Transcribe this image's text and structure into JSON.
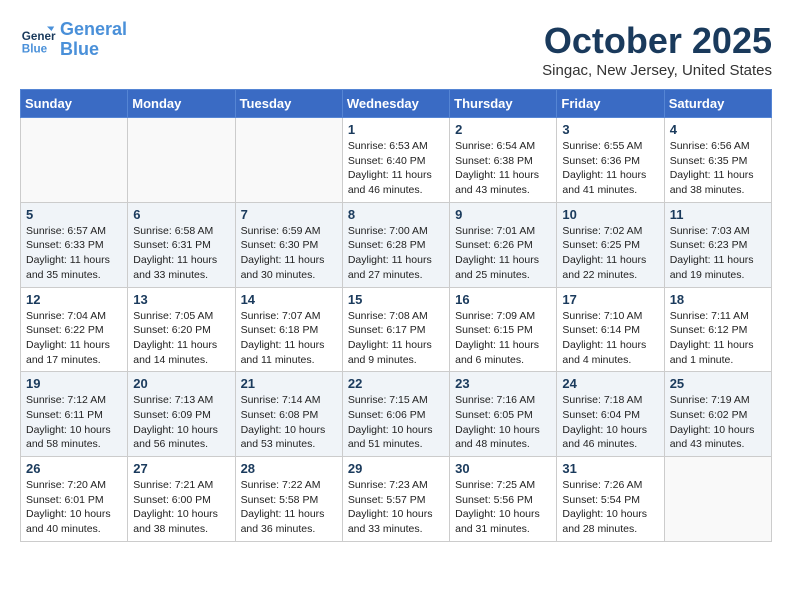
{
  "logo": {
    "line1": "General",
    "line2": "Blue"
  },
  "title": "October 2025",
  "location": "Singac, New Jersey, United States",
  "days_of_week": [
    "Sunday",
    "Monday",
    "Tuesday",
    "Wednesday",
    "Thursday",
    "Friday",
    "Saturday"
  ],
  "weeks": [
    [
      {
        "day": "",
        "info": ""
      },
      {
        "day": "",
        "info": ""
      },
      {
        "day": "",
        "info": ""
      },
      {
        "day": "1",
        "info": "Sunrise: 6:53 AM\nSunset: 6:40 PM\nDaylight: 11 hours and 46 minutes."
      },
      {
        "day": "2",
        "info": "Sunrise: 6:54 AM\nSunset: 6:38 PM\nDaylight: 11 hours and 43 minutes."
      },
      {
        "day": "3",
        "info": "Sunrise: 6:55 AM\nSunset: 6:36 PM\nDaylight: 11 hours and 41 minutes."
      },
      {
        "day": "4",
        "info": "Sunrise: 6:56 AM\nSunset: 6:35 PM\nDaylight: 11 hours and 38 minutes."
      }
    ],
    [
      {
        "day": "5",
        "info": "Sunrise: 6:57 AM\nSunset: 6:33 PM\nDaylight: 11 hours and 35 minutes."
      },
      {
        "day": "6",
        "info": "Sunrise: 6:58 AM\nSunset: 6:31 PM\nDaylight: 11 hours and 33 minutes."
      },
      {
        "day": "7",
        "info": "Sunrise: 6:59 AM\nSunset: 6:30 PM\nDaylight: 11 hours and 30 minutes."
      },
      {
        "day": "8",
        "info": "Sunrise: 7:00 AM\nSunset: 6:28 PM\nDaylight: 11 hours and 27 minutes."
      },
      {
        "day": "9",
        "info": "Sunrise: 7:01 AM\nSunset: 6:26 PM\nDaylight: 11 hours and 25 minutes."
      },
      {
        "day": "10",
        "info": "Sunrise: 7:02 AM\nSunset: 6:25 PM\nDaylight: 11 hours and 22 minutes."
      },
      {
        "day": "11",
        "info": "Sunrise: 7:03 AM\nSunset: 6:23 PM\nDaylight: 11 hours and 19 minutes."
      }
    ],
    [
      {
        "day": "12",
        "info": "Sunrise: 7:04 AM\nSunset: 6:22 PM\nDaylight: 11 hours and 17 minutes."
      },
      {
        "day": "13",
        "info": "Sunrise: 7:05 AM\nSunset: 6:20 PM\nDaylight: 11 hours and 14 minutes."
      },
      {
        "day": "14",
        "info": "Sunrise: 7:07 AM\nSunset: 6:18 PM\nDaylight: 11 hours and 11 minutes."
      },
      {
        "day": "15",
        "info": "Sunrise: 7:08 AM\nSunset: 6:17 PM\nDaylight: 11 hours and 9 minutes."
      },
      {
        "day": "16",
        "info": "Sunrise: 7:09 AM\nSunset: 6:15 PM\nDaylight: 11 hours and 6 minutes."
      },
      {
        "day": "17",
        "info": "Sunrise: 7:10 AM\nSunset: 6:14 PM\nDaylight: 11 hours and 4 minutes."
      },
      {
        "day": "18",
        "info": "Sunrise: 7:11 AM\nSunset: 6:12 PM\nDaylight: 11 hours and 1 minute."
      }
    ],
    [
      {
        "day": "19",
        "info": "Sunrise: 7:12 AM\nSunset: 6:11 PM\nDaylight: 10 hours and 58 minutes."
      },
      {
        "day": "20",
        "info": "Sunrise: 7:13 AM\nSunset: 6:09 PM\nDaylight: 10 hours and 56 minutes."
      },
      {
        "day": "21",
        "info": "Sunrise: 7:14 AM\nSunset: 6:08 PM\nDaylight: 10 hours and 53 minutes."
      },
      {
        "day": "22",
        "info": "Sunrise: 7:15 AM\nSunset: 6:06 PM\nDaylight: 10 hours and 51 minutes."
      },
      {
        "day": "23",
        "info": "Sunrise: 7:16 AM\nSunset: 6:05 PM\nDaylight: 10 hours and 48 minutes."
      },
      {
        "day": "24",
        "info": "Sunrise: 7:18 AM\nSunset: 6:04 PM\nDaylight: 10 hours and 46 minutes."
      },
      {
        "day": "25",
        "info": "Sunrise: 7:19 AM\nSunset: 6:02 PM\nDaylight: 10 hours and 43 minutes."
      }
    ],
    [
      {
        "day": "26",
        "info": "Sunrise: 7:20 AM\nSunset: 6:01 PM\nDaylight: 10 hours and 40 minutes."
      },
      {
        "day": "27",
        "info": "Sunrise: 7:21 AM\nSunset: 6:00 PM\nDaylight: 10 hours and 38 minutes."
      },
      {
        "day": "28",
        "info": "Sunrise: 7:22 AM\nSunset: 5:58 PM\nDaylight: 11 hours and 36 minutes."
      },
      {
        "day": "29",
        "info": "Sunrise: 7:23 AM\nSunset: 5:57 PM\nDaylight: 10 hours and 33 minutes."
      },
      {
        "day": "30",
        "info": "Sunrise: 7:25 AM\nSunset: 5:56 PM\nDaylight: 10 hours and 31 minutes."
      },
      {
        "day": "31",
        "info": "Sunrise: 7:26 AM\nSunset: 5:54 PM\nDaylight: 10 hours and 28 minutes."
      },
      {
        "day": "",
        "info": ""
      }
    ]
  ]
}
